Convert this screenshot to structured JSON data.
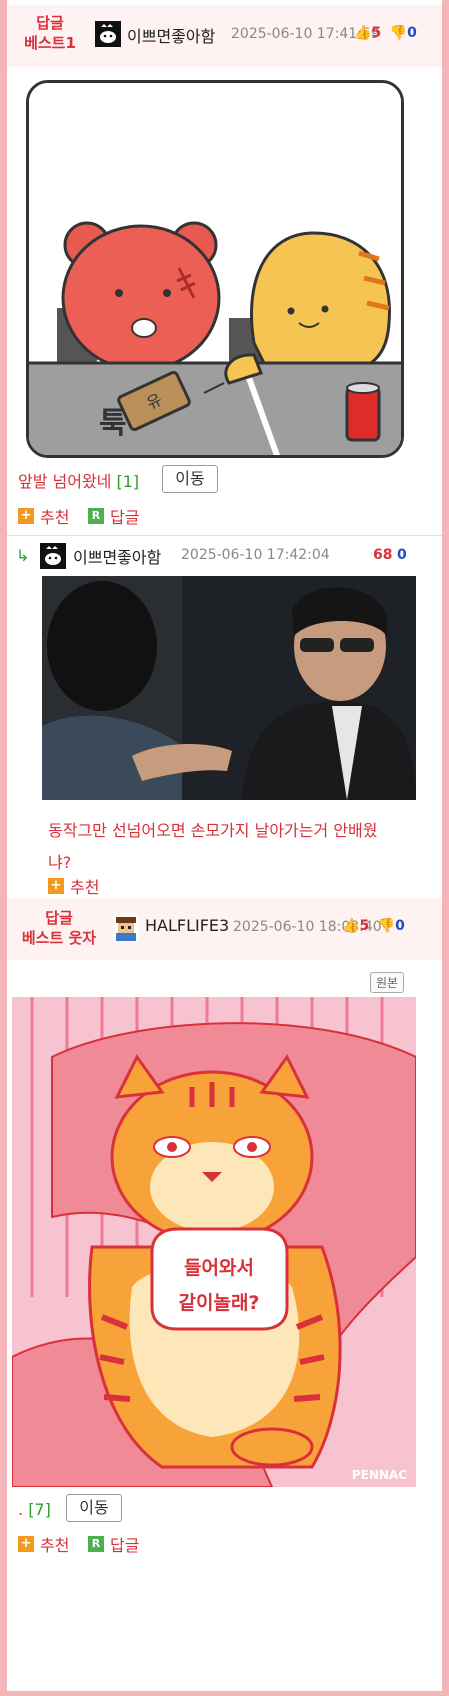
{
  "comments": [
    {
      "badge_line1": "답글",
      "badge_line2": "베스트1",
      "nick": "이쁘면좋아함",
      "date": "2025-06-10 17:41:59",
      "up_count": "5",
      "down_count": "0",
      "comic_sound": "툭",
      "snack_label": "유",
      "text": "앞발 넘어왔네",
      "reply_count": "[1]",
      "move_label": "이동",
      "recommend_label": "추천",
      "reply_label": "답글"
    },
    {
      "nick": "이쁘면좋아함",
      "date": "2025-06-10 17:42:04",
      "up_count": "68",
      "down_count": "0",
      "text_line1": "동작그만 선넘어오면 손모가지 날아가는거 안배웠",
      "text_line2": "냐?",
      "recommend_label": "추천"
    },
    {
      "badge_line1": "답글",
      "badge_line2": "베스트 웃자",
      "nick": "HALFLIFE3",
      "date": "2025-06-10 18:03:40",
      "up_count": "5",
      "down_count": "0",
      "original_label": "원본",
      "bubble_line1": "들어와서",
      "bubble_line2": "같이놀래?",
      "signature": "PENNAC",
      "text": ".",
      "reply_count": "[7]",
      "move_label": "이동",
      "recommend_label": "추천",
      "reply_label": "답글"
    }
  ],
  "colors": {
    "accent_red": "#d9313a",
    "down_blue": "#1e4fc8",
    "frame_pink": "#f3b5b8",
    "count_green": "#2e9f2e"
  }
}
